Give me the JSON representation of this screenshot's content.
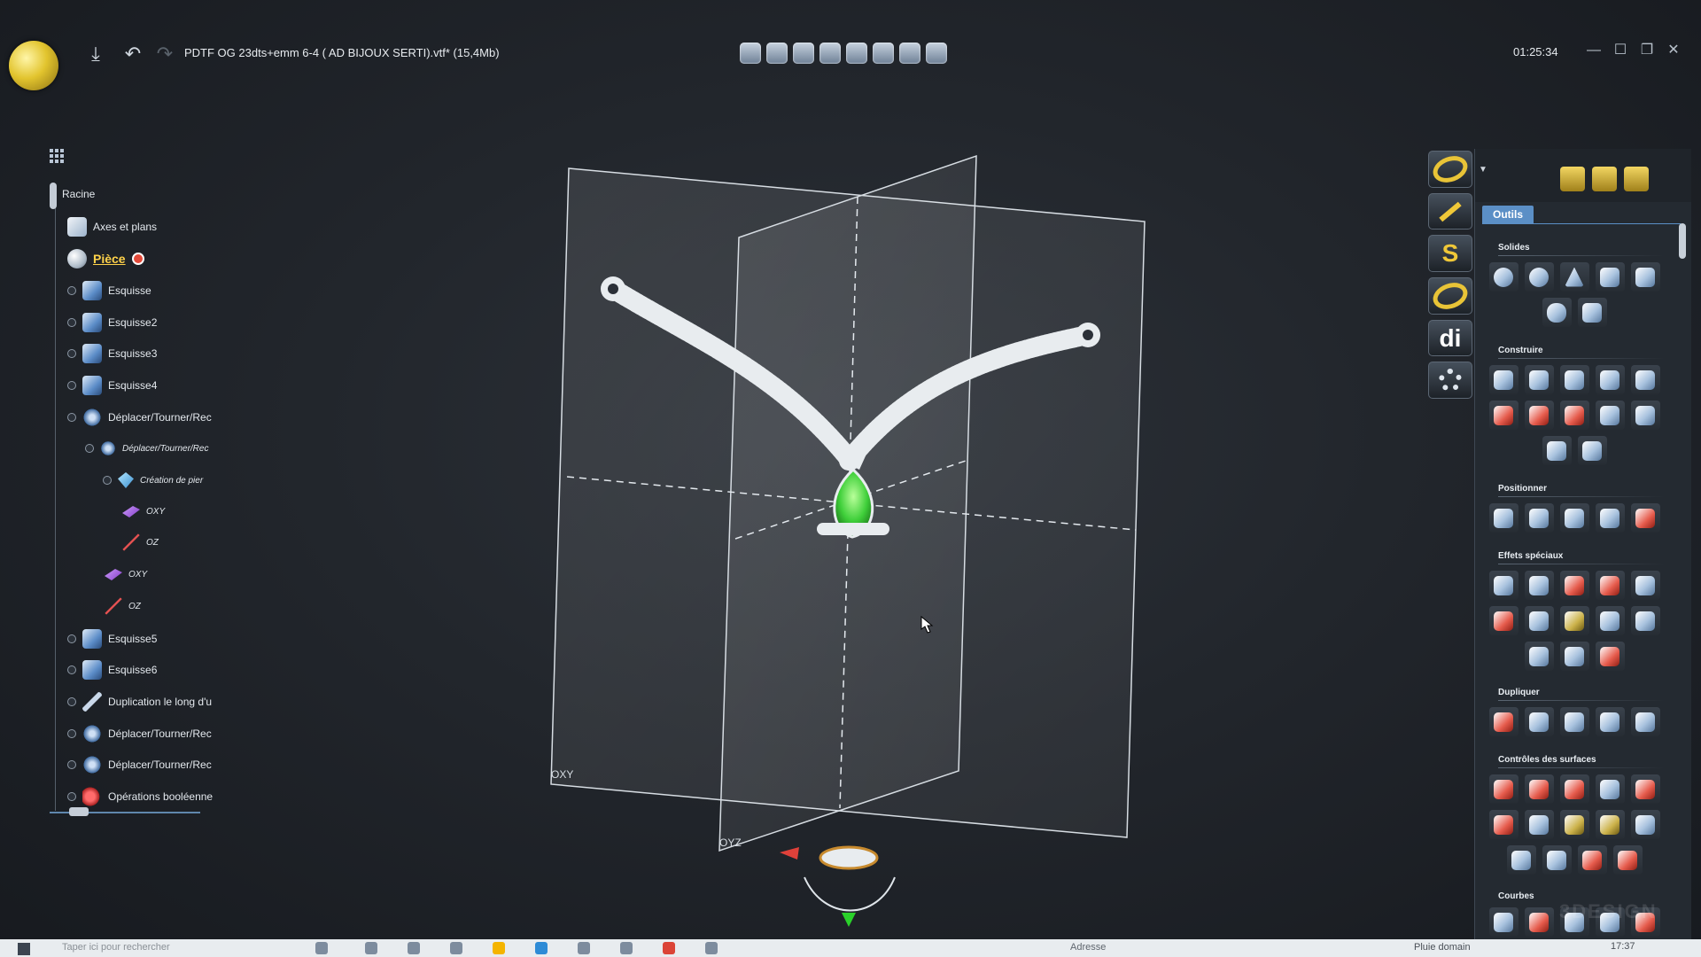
{
  "window": {
    "title": "PDTF OG 23dts+emm 6-4 ( AD BIJOUX SERTI).vtf* (15,4Mb)",
    "clock": "01:25:34"
  },
  "tree": {
    "items": [
      {
        "label": "Racine",
        "icon": "root-icon"
      },
      {
        "label": "Axes et plans",
        "icon": "axes-planes-icon"
      },
      {
        "label": "Pièce",
        "icon": "part-icon"
      },
      {
        "label": "Esquisse",
        "icon": "sketch-icon"
      },
      {
        "label": "Esquisse2",
        "icon": "sketch-icon"
      },
      {
        "label": "Esquisse3",
        "icon": "sketch-icon"
      },
      {
        "label": "Esquisse4",
        "icon": "sketch-icon"
      },
      {
        "label": "Déplacer/Tourner/Rec",
        "icon": "move-rotate-icon"
      },
      {
        "label": "Déplacer/Tourner/Rec",
        "icon": "move-rotate-icon"
      },
      {
        "label": "Création de pier",
        "icon": "gem-icon"
      },
      {
        "label": "OXY",
        "icon": "plane-icon"
      },
      {
        "label": "OZ",
        "icon": "axis-icon"
      },
      {
        "label": "OXY",
        "icon": "plane-icon"
      },
      {
        "label": "OZ",
        "icon": "axis-icon"
      },
      {
        "label": "Esquisse5",
        "icon": "sketch-icon"
      },
      {
        "label": "Esquisse6",
        "icon": "sketch-icon"
      },
      {
        "label": "Duplication le long d'u",
        "icon": "duplicate-icon"
      },
      {
        "label": "Déplacer/Tourner/Rec",
        "icon": "move-rotate-icon"
      },
      {
        "label": "Déplacer/Tourner/Rec",
        "icon": "move-rotate-icon"
      },
      {
        "label": "Opérations booléenne",
        "icon": "boolean-icon"
      }
    ]
  },
  "viewport": {
    "plane_oxy_label": "OXY",
    "plane_oyz_label": "OYZ",
    "gem_color": "#3fcf3a",
    "metal_color": "#e8ecef"
  },
  "side_strip": {
    "di_label": "di"
  },
  "panel": {
    "tab_label": "Outils",
    "sections": {
      "solides": "Solides",
      "construire": "Construire",
      "positionner": "Positionner",
      "effets": "Effets spéciaux",
      "dupliquer": "Dupliquer",
      "controles": "Contrôles des surfaces",
      "courbes": "Courbes"
    }
  },
  "taskbar": {
    "search_placeholder": "Taper ici pour rechercher",
    "address_label": "Adresse",
    "weather": "Pluie domain",
    "time": "17:37"
  },
  "brand_watermark": "3DESIGN",
  "colors": {
    "accent": "#5b8fc6",
    "gold": "#e9c437",
    "background": "#22262c"
  }
}
